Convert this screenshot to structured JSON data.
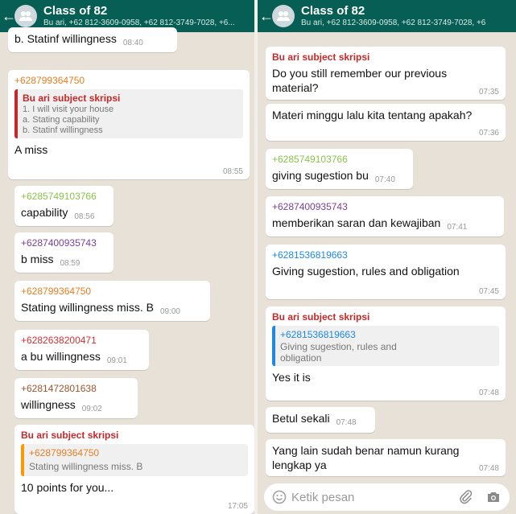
{
  "colors": {
    "header": "#075e54",
    "orange": "#e67e22",
    "green": "#8bc34a",
    "purple": "#7b3f9e",
    "red": "#d32f2f",
    "brown": "#a0522d",
    "blue": "#1e88e5",
    "quote_bar_red": "#c62828",
    "quote_bar_orange": "#ff9800",
    "quote_bar_blue": "#1e88e5"
  },
  "left": {
    "header": {
      "title": "Class of 82",
      "subtitle": "Bu ari, +62 812-3609-0958, +62 812-3749-7028, +6..."
    },
    "messages": [
      {
        "text": "b. Statinf willingness",
        "time": "08:40"
      },
      {
        "sender": "+628799364750",
        "quote": {
          "sender": "Bu ari subject skripsi",
          "lines": [
            "1. I will visit your house",
            "a. Stating capability",
            "b. Statinf willingness"
          ]
        },
        "text": "A miss",
        "time": "08:55"
      },
      {
        "sender": "+6285749103766",
        "text": "capability",
        "time": "08:56"
      },
      {
        "sender": "+6287400935743",
        "text": "b miss",
        "time": "08:59"
      },
      {
        "sender": "+628799364750",
        "text": "Stating willingness miss. B",
        "time": "09:00"
      },
      {
        "sender": "+6282638200471",
        "text": "a bu willingness",
        "time": "09:01"
      },
      {
        "sender": "+6281472801638",
        "text": "willingness",
        "time": "09:02"
      },
      {
        "sender": "Bu ari subject skripsi",
        "quote": {
          "sender": "+628799364750",
          "lines": [
            "Stating willingness miss. B"
          ]
        },
        "text": "10 points for you...",
        "time": "17:05"
      }
    ]
  },
  "right": {
    "header": {
      "title": "Class of 82",
      "subtitle": "Bu ari, +62 812-3609-0958, +62 812-3749-7028, +6"
    },
    "messages": [
      {
        "sender": "Bu ari subject skripsi",
        "text": "Do you still remember our previous material?",
        "time": "07:35"
      },
      {
        "text": "Materi minggu lalu kita tentang apakah?",
        "time": "07:36"
      },
      {
        "sender": "+6285749103766",
        "text": "giving sugestion bu",
        "time": "07:40"
      },
      {
        "sender": "+6287400935743",
        "text": "memberikan saran dan kewajiban",
        "time": "07:41"
      },
      {
        "sender": "+6281536819663",
        "text": "Giving sugestion, rules and obligation",
        "time": "07:45"
      },
      {
        "sender": "Bu ari subject skripsi",
        "quote": {
          "sender": "+6281536819663",
          "lines": [
            "Giving sugestion, rules and obligation"
          ]
        },
        "text": "Yes it is",
        "time": "07:48"
      },
      {
        "text": "Betul sekali",
        "time": "07:48"
      },
      {
        "text": "Yang lain sudah benar namun kurang lengkap ya",
        "time": "07:48"
      }
    ],
    "composer": {
      "placeholder": "Ketik pesan",
      "emoji_icon": "emoji-icon",
      "attach_icon": "paperclip-icon",
      "camera_icon": "camera-icon"
    }
  }
}
